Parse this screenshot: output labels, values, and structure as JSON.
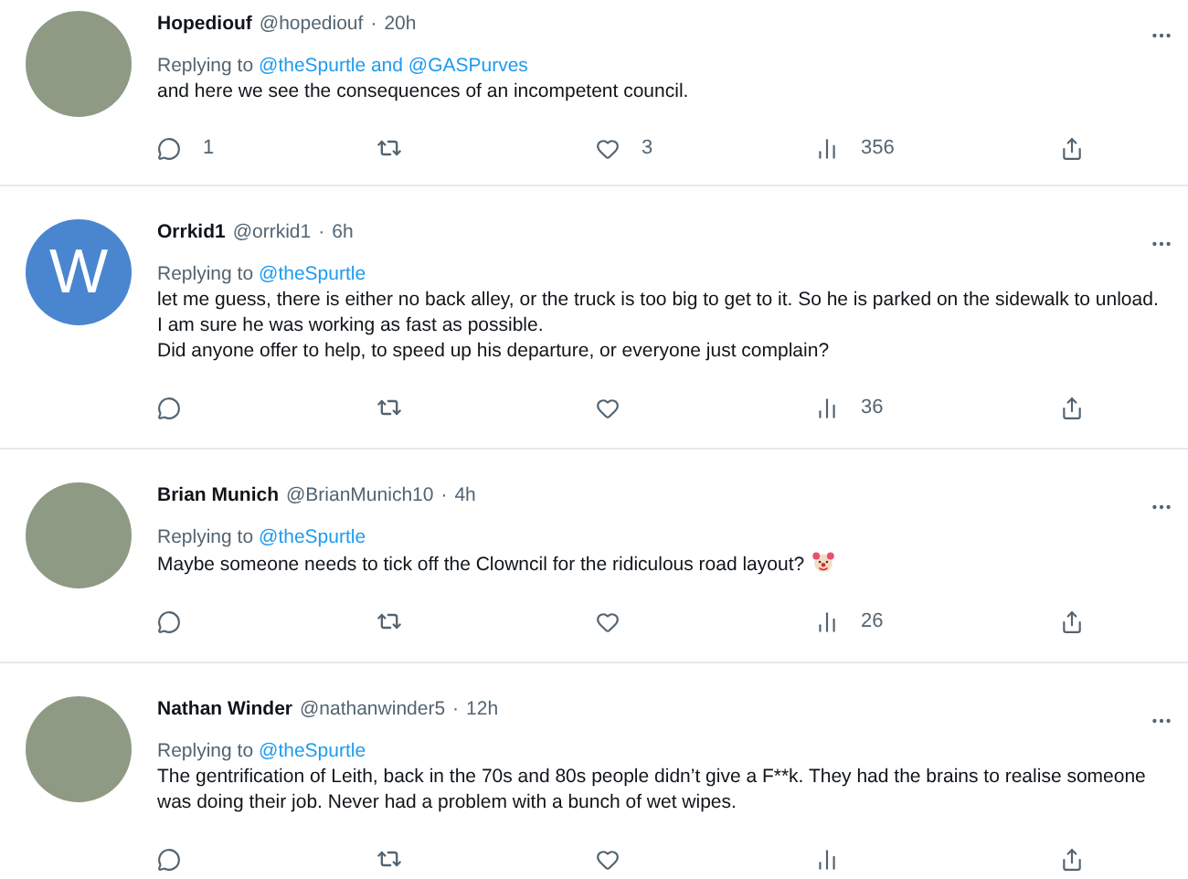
{
  "replies": [
    {
      "avatar": {
        "kind": "photo"
      },
      "name": "Hopediouf",
      "handle": "@hopediouf",
      "separator": "·",
      "time": "20h",
      "replying_label": "Replying to",
      "replying_to": "@theSpurtle and @GASPurves",
      "text": "and here we see the consequences of an incompetent council.",
      "emoji": false,
      "replies_count": "1",
      "likes_count": "3",
      "views_count": "356"
    },
    {
      "avatar": {
        "kind": "letter",
        "letter": "W"
      },
      "name": "Orrkid1",
      "handle": "@orrkid1",
      "separator": "·",
      "time": "6h",
      "replying_label": "Replying to",
      "replying_to": "@theSpurtle",
      "text": "let me guess, there is either no back alley, or the truck is too big to get to it.  So he is parked on the sidewalk to unload.\nI am sure he was working as fast as possible.\nDid anyone offer to help, to speed up his departure, or everyone just complain?",
      "emoji": false,
      "views_count": "36"
    },
    {
      "avatar": {
        "kind": "photo"
      },
      "name": "Brian Munich",
      "handle": "@BrianMunich10",
      "separator": "·",
      "time": "4h",
      "replying_label": "Replying to",
      "replying_to": "@theSpurtle",
      "text": "Maybe someone needs to tick off the  Clowncil for the ridiculous road layout?",
      "emoji": true,
      "views_count": "26"
    },
    {
      "avatar": {
        "kind": "photo"
      },
      "name": "Nathan Winder",
      "handle": "@nathanwinder5",
      "separator": "·",
      "time": "12h",
      "replying_label": "Replying to",
      "replying_to": "@theSpurtle",
      "text": "The gentrification of Leith, back in the 70s and 80s people didn’t give a F**k. They had the brains to realise someone was doing their job. Never had a problem with a bunch of wet wipes.",
      "emoji": false
    }
  ]
}
